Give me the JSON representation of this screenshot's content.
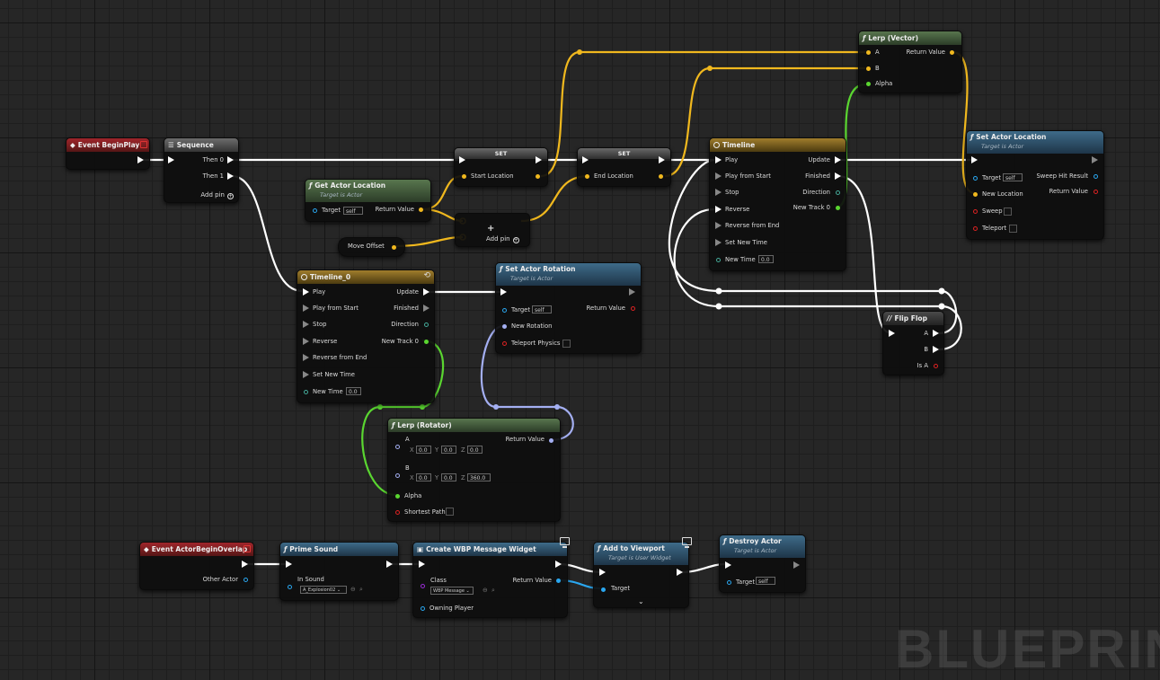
{
  "watermark": "BLUEPRINT",
  "colors": {
    "exec": "#ffffff",
    "vector": "#f0b81e",
    "float": "#5ad630",
    "rotator": "#a4aff2",
    "object": "#2aa7f0"
  },
  "icons": {
    "function": "function-icon",
    "timeline": "clock-icon",
    "sequence": "sequence-icon",
    "flipflop": "flipflop-icon",
    "widget": "monitor-icon"
  },
  "nodes": {
    "event_beginplay": {
      "title": "Event BeginPlay"
    },
    "sequence": {
      "title": "Sequence",
      "then0": "Then 0",
      "then1": "Then 1",
      "add_pin": "Add pin"
    },
    "get_actor_location": {
      "title": "Get Actor Location",
      "subtitle": "Target is Actor",
      "target": "Target",
      "target_value": "self",
      "return_value": "Return Value"
    },
    "move_offset": {
      "title": "Move Offset"
    },
    "set1": {
      "title": "SET",
      "pin": "Start Location"
    },
    "set2": {
      "title": "SET",
      "pin": "End Location"
    },
    "add": {
      "symbol": "+",
      "add_pin": "Add pin"
    },
    "lerp_vector": {
      "title": "Lerp (Vector)",
      "a": "A",
      "b": "B",
      "alpha": "Alpha",
      "return_value": "Return Value"
    },
    "timeline": {
      "title": "Timeline",
      "play": "Play",
      "play_from_start": "Play from Start",
      "stop": "Stop",
      "reverse": "Reverse",
      "reverse_from_end": "Reverse from End",
      "set_new_time": "Set New Time",
      "new_time": "New Time",
      "new_time_value": "0.0",
      "update": "Update",
      "finished": "Finished",
      "direction": "Direction",
      "new_track": "New Track 0"
    },
    "set_actor_location": {
      "title": "Set Actor Location",
      "subtitle": "Target is Actor",
      "target": "Target",
      "target_value": "self",
      "new_location": "New Location",
      "sweep": "Sweep",
      "teleport": "Teleport",
      "sweep_hit_result": "Sweep Hit Result",
      "return_value": "Return Value"
    },
    "flip_flop": {
      "title": "Flip Flop",
      "a": "A",
      "b": "B",
      "is_a": "Is A"
    },
    "timeline_0": {
      "title": "Timeline_0",
      "play": "Play",
      "play_from_start": "Play from Start",
      "stop": "Stop",
      "reverse": "Reverse",
      "reverse_from_end": "Reverse from End",
      "set_new_time": "Set New Time",
      "new_time": "New Time",
      "new_time_value": "0.0",
      "update": "Update",
      "finished": "Finished",
      "direction": "Direction",
      "new_track": "New Track 0"
    },
    "set_actor_rotation": {
      "title": "Set Actor Rotation",
      "subtitle": "Target is Actor",
      "target": "Target",
      "target_value": "self",
      "new_rotation": "New Rotation",
      "teleport_physics": "Teleport Physics",
      "return_value": "Return Value"
    },
    "lerp_rotator": {
      "title": "Lerp (Rotator)",
      "a": "A",
      "b": "B",
      "alpha": "Alpha",
      "shortest_path": "Shortest Path",
      "return_value": "Return Value",
      "x": "X",
      "y": "Y",
      "z": "Z",
      "a_x": "0.0",
      "a_y": "0.0",
      "a_z": "0.0",
      "b_x": "0.0",
      "b_y": "0.0",
      "b_z": "360.0"
    },
    "event_overlap": {
      "title": "Event ActorBeginOverlap",
      "other_actor": "Other Actor"
    },
    "prime_sound": {
      "title": "Prime Sound",
      "in_sound": "In Sound",
      "sound_value": "A_Explosion02"
    },
    "create_widget": {
      "title": "Create WBP Message Widget",
      "class": "Class",
      "class_value": "WBP Message",
      "owning_player": "Owning Player",
      "return_value": "Return Value"
    },
    "add_to_viewport": {
      "title": "Add to Viewport",
      "subtitle": "Target is User Widget",
      "target": "Target"
    },
    "destroy_actor": {
      "title": "Destroy Actor",
      "subtitle": "Target is Actor",
      "target": "Target",
      "target_value": "self"
    }
  }
}
